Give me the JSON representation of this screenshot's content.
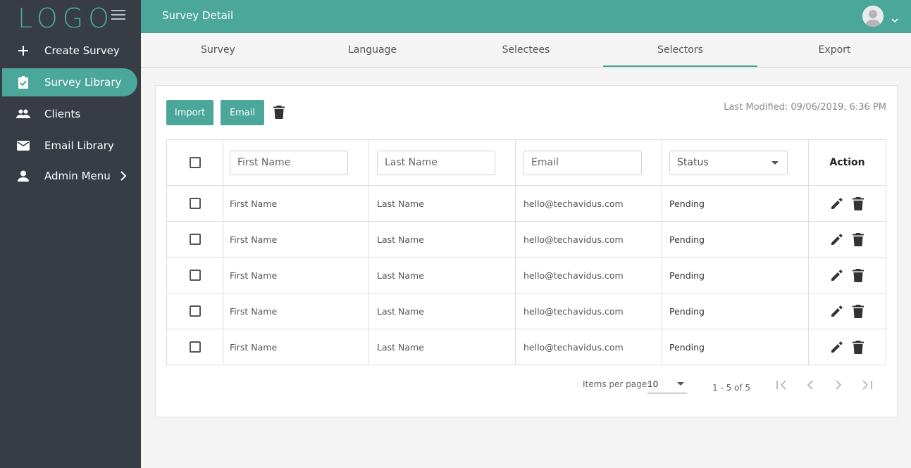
{
  "sidebar": {
    "logo": "LOGO",
    "items": [
      {
        "label": "Create Survey",
        "icon": "plus-icon"
      },
      {
        "label": "Survey Library",
        "icon": "clipboard-check-icon",
        "active": true
      },
      {
        "label": "Clients",
        "icon": "people-icon"
      },
      {
        "label": "Email Library",
        "icon": "mail-icon"
      },
      {
        "label": "Admin Menu",
        "icon": "person-icon"
      }
    ]
  },
  "topbar": {
    "title": "Survey Detail"
  },
  "tabs": [
    {
      "label": "Survey"
    },
    {
      "label": "Language"
    },
    {
      "label": "Selectees"
    },
    {
      "label": "Selectors",
      "active": true
    },
    {
      "label": "Export"
    }
  ],
  "toolbar": {
    "import_label": "Import",
    "email_label": "Email",
    "last_modified": "Last Modified: 09/06/2019, 6:36 PM"
  },
  "table": {
    "filters": {
      "first_name_placeholder": "First Name",
      "last_name_placeholder": "Last Name",
      "email_placeholder": "Email",
      "status_placeholder": "Status"
    },
    "action_header": "Action",
    "rows": [
      {
        "first": "First Name",
        "last": "Last Name",
        "email": "hello@techavidus.com",
        "status": "Pending"
      },
      {
        "first": "First Name",
        "last": "Last Name",
        "email": "hello@techavidus.com",
        "status": "Pending"
      },
      {
        "first": "First Name",
        "last": "Last Name",
        "email": "hello@techavidus.com",
        "status": "Pending"
      },
      {
        "first": "First Name",
        "last": "Last Name",
        "email": "hello@techavidus.com",
        "status": "Pending"
      },
      {
        "first": "First Name",
        "last": "Last Name",
        "email": "hello@techavidus.com",
        "status": "Pending"
      }
    ]
  },
  "pagination": {
    "items_per_page_label": "Items per page:",
    "items_per_page": "10",
    "range": "1 - 5 of 5"
  },
  "colors": {
    "accent": "#4aa79a",
    "sidebar": "#383c45"
  }
}
